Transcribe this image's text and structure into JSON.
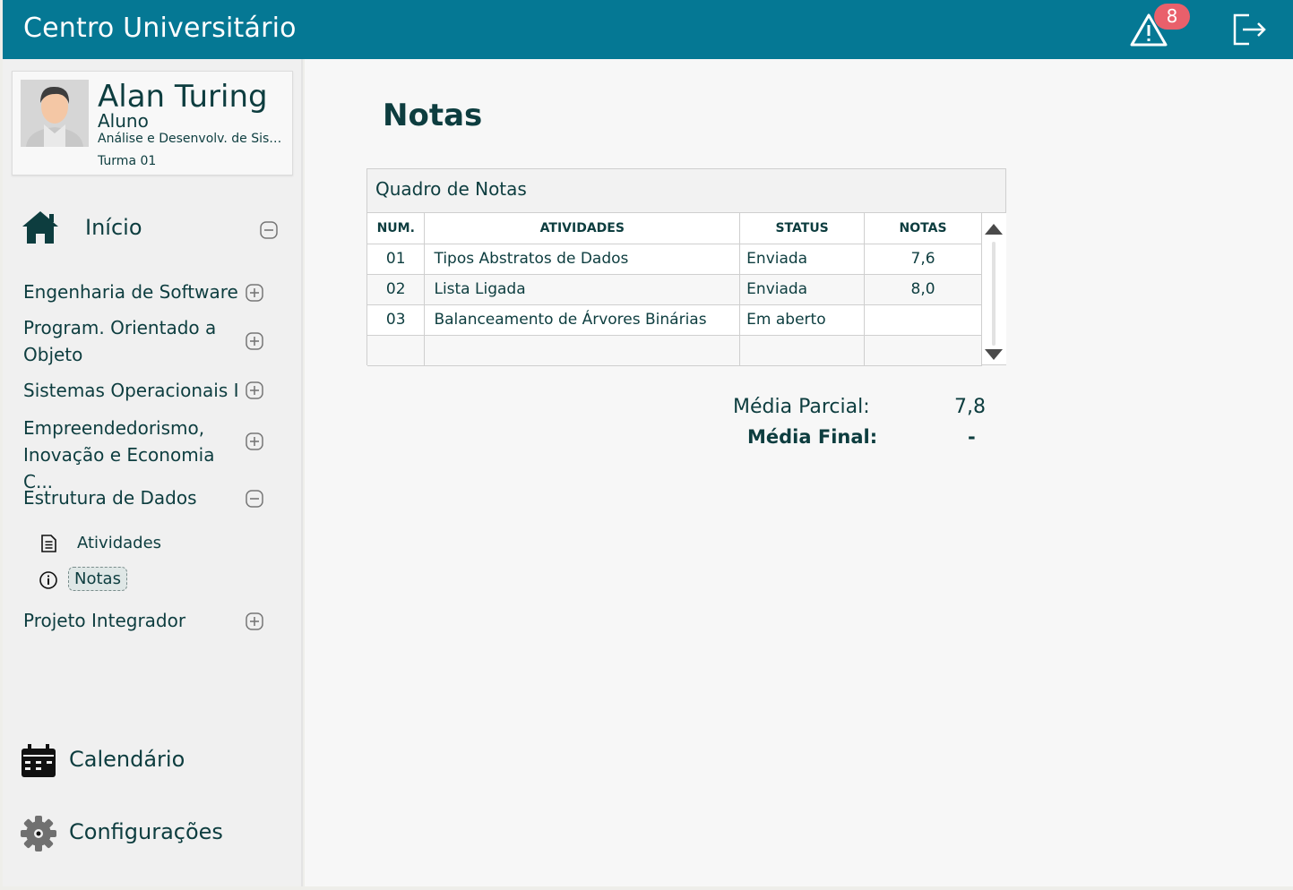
{
  "header": {
    "app_title": "Centro Universitário",
    "alert_count": "8",
    "colors": {
      "bar": "#057894",
      "badge": "#e9606b"
    }
  },
  "profile": {
    "name": "Alan Turing",
    "role": "Aluno",
    "course": "Análise e Desenvolv. de Sistemas",
    "class": "Turma 01"
  },
  "nav": {
    "home_label": "Início",
    "courses": [
      {
        "label": "Engenharia de Software",
        "expanded": false
      },
      {
        "label": "Program. Orientado a Objeto",
        "expanded": false
      },
      {
        "label": "Sistemas Operacionais I",
        "expanded": false
      },
      {
        "label": "Empreendedorismo, Inovação e Economia C...",
        "expanded": false
      },
      {
        "label": "Estrutura de Dados",
        "expanded": true
      },
      {
        "label": "Projeto Integrador",
        "expanded": false
      }
    ],
    "sub_items": [
      {
        "label": "Atividades",
        "icon": "document-icon"
      },
      {
        "label": "Notas",
        "icon": "info-icon",
        "active": true
      }
    ],
    "calendar_label": "Calendário",
    "settings_label": "Configurações"
  },
  "main": {
    "title": "Notas",
    "grades_box_title": "Quadro de Notas",
    "columns": [
      "NUM.",
      "ATIVIDADES",
      "STATUS",
      "NOTAS"
    ],
    "rows": [
      {
        "num": "01",
        "activity": "Tipos Abstratos de Dados",
        "status": "Enviada",
        "grade": "7,6"
      },
      {
        "num": "02",
        "activity": "Lista Ligada",
        "status": "Enviada",
        "grade": "8,0"
      },
      {
        "num": "03",
        "activity": "Balanceamento de Árvores Binárias",
        "status": "Em aberto",
        "grade": ""
      },
      {
        "num": "",
        "activity": "",
        "status": "",
        "grade": ""
      }
    ],
    "partial_avg_label": "Média Parcial:",
    "partial_avg_value": "7,8",
    "final_avg_label": "Média Final:",
    "final_avg_value": "-"
  }
}
